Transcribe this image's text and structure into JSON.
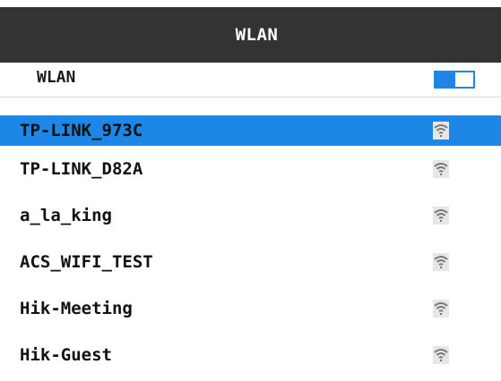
{
  "header": {
    "title": "WLAN"
  },
  "wlan_switch": {
    "label": "WLAN",
    "state": "on"
  },
  "networks": [
    {
      "ssid": "TP-LINK_973C",
      "selected": true,
      "icon": "wifi-signal-icon"
    },
    {
      "ssid": "TP-LINK_D82A",
      "selected": false,
      "icon": "wifi-signal-icon"
    },
    {
      "ssid": "a_la_king",
      "selected": false,
      "icon": "wifi-signal-icon"
    },
    {
      "ssid": "ACS_WIFI_TEST",
      "selected": false,
      "icon": "wifi-signal-icon"
    },
    {
      "ssid": "Hik-Meeting",
      "selected": false,
      "icon": "wifi-signal-icon"
    },
    {
      "ssid": "Hik-Guest",
      "selected": false,
      "icon": "wifi-signal-icon"
    }
  ],
  "colors": {
    "header_bg": "#333333",
    "accent": "#1e86e4",
    "icon": "#777777"
  }
}
